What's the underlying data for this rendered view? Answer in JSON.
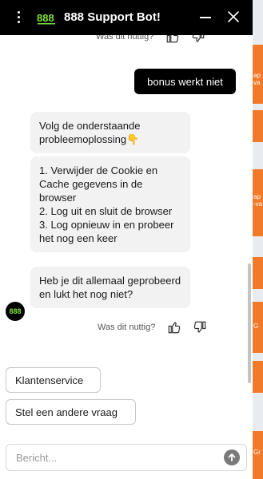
{
  "header": {
    "title": "888 Support Bot!"
  },
  "feedback": {
    "label": "Was dit nuttig?"
  },
  "messages": {
    "user_1": "bonus werkt niet",
    "bot_1": "Volg de onderstaande probleemoplossing👇",
    "bot_2_lines": [
      "1. Verwijder de Cookie en Cache gegevens in de browser",
      "2. Log uit en sluit de browser",
      "3. Log opnieuw in en probeer het nog een keer"
    ],
    "bot_3": "Heb je dit allemaal geprobeerd en lukt het nog niet?"
  },
  "quick_replies": [
    "Klantenservice",
    "Stel een andere vraag"
  ],
  "input": {
    "placeholder": "Bericht..."
  },
  "colors": {
    "brand_green": "#7ee03a",
    "header_bg": "#000000",
    "strip_orange": "#f07a2a"
  },
  "background_strip": [
    "ap",
    "va",
    "ap",
    "-va",
    "G",
    "Gr"
  ]
}
